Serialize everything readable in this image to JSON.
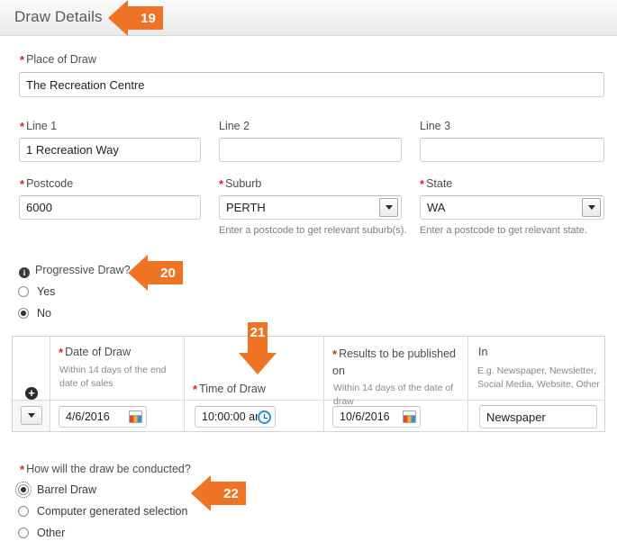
{
  "header": {
    "title": "Draw Details"
  },
  "callouts": [
    {
      "number": "19",
      "direction": "left"
    },
    {
      "number": "20",
      "direction": "left"
    },
    {
      "number": "21",
      "direction": "down"
    },
    {
      "number": "22",
      "direction": "left"
    }
  ],
  "form": {
    "place_of_draw": {
      "label": "Place of Draw",
      "required": "*",
      "value": "The Recreation Centre"
    },
    "line1": {
      "label": "Line 1",
      "required": "*",
      "value": "1 Recreation Way"
    },
    "line2": {
      "label": "Line 2",
      "value": ""
    },
    "line3": {
      "label": "Line 3",
      "value": ""
    },
    "postcode": {
      "label": "Postcode",
      "required": "*",
      "value": "6000"
    },
    "suburb": {
      "label": "Suburb",
      "required": "*",
      "value": "PERTH",
      "hint": "Enter a postcode to get relevant suburb(s).",
      "icon": "chevron-down-icon"
    },
    "state": {
      "label": "State",
      "required": "*",
      "value": "WA",
      "hint": "Enter a postcode to get relevant state.",
      "icon": "chevron-down-icon"
    },
    "progressive_draw": {
      "label": "Progressive Draw?",
      "info_icon": "info-icon",
      "info_glyph": "i",
      "options": [
        {
          "label": "Yes",
          "selected": false
        },
        {
          "label": "No",
          "selected": true
        }
      ]
    },
    "draw_conducted": {
      "label": "How will the draw be conducted?",
      "required": "*",
      "options": [
        {
          "label": "Barrel Draw",
          "selected": true,
          "focused": true
        },
        {
          "label": "Computer generated selection",
          "selected": false,
          "focused": false
        },
        {
          "label": "Other",
          "selected": false,
          "focused": false
        }
      ]
    }
  },
  "draw_table": {
    "add_row_glyph": "+",
    "add_row_icon": "add-row-icon",
    "row_menu_icon": "chevron-down-icon",
    "columns": [
      {
        "title": "Date of Draw",
        "required": "*",
        "sub": "Within 14 days of the end date of sales"
      },
      {
        "title": "Time of Draw",
        "required": "*",
        "sub": ""
      },
      {
        "title": "Results to be published on",
        "required": "*",
        "sub": "Within 14 days of the date of draw"
      },
      {
        "title": "In",
        "required": "",
        "sub": "E.g. Newspaper, Newsletter, Social Media, Website, Other"
      }
    ],
    "rows": [
      {
        "date_of_draw": "4/6/2016",
        "date_icon": "calendar-icon",
        "time_of_draw": "10:00:00 am",
        "time_icon": "clock-icon",
        "results_published_on": "10/6/2016",
        "results_icon": "calendar-icon",
        "published_in": "Newspaper"
      }
    ]
  },
  "colors": {
    "callout_orange": "#ee7324",
    "required_red": "#cc2a22"
  }
}
